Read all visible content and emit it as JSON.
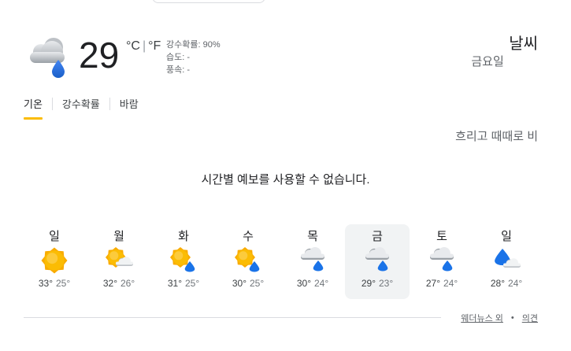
{
  "current": {
    "temperature": "29",
    "unit_c": "°C",
    "unit_sep": "|",
    "unit_f": "°F",
    "icon": "cloud-with-rain-icon",
    "precip": "강수확률: 90%",
    "humidity": "습도: -",
    "wind": "풍속: -"
  },
  "place": {
    "title": "날씨",
    "day": "금요일",
    "condition": "흐리고 때때로 비"
  },
  "tabs": [
    "기온",
    "강수확률",
    "바람"
  ],
  "active_tab": 0,
  "message": "시간별 예보를 사용할 수 없습니다.",
  "days": [
    {
      "name": "일",
      "icon": "sun-icon",
      "high": "33°",
      "low": "25°"
    },
    {
      "name": "월",
      "icon": "sun-cloud-icon",
      "high": "32°",
      "low": "26°"
    },
    {
      "name": "화",
      "icon": "sun-rain-icon",
      "high": "31°",
      "low": "25°"
    },
    {
      "name": "수",
      "icon": "sun-rain-icon",
      "high": "30°",
      "low": "25°"
    },
    {
      "name": "목",
      "icon": "cloud-rain-icon",
      "high": "30°",
      "low": "24°"
    },
    {
      "name": "금",
      "icon": "cloud-rain-icon",
      "high": "29°",
      "low": "23°",
      "selected": true
    },
    {
      "name": "토",
      "icon": "cloud-rain-icon",
      "high": "27°",
      "low": "24°"
    },
    {
      "name": "일",
      "icon": "rain-cloud-icon",
      "high": "28°",
      "low": "24°"
    }
  ],
  "footer": {
    "source": "웨더뉴스 외",
    "separator": "•",
    "feedback": "의견"
  },
  "colors": {
    "sun": "#fbbc04",
    "sun_edge": "#f29900",
    "cloud": "#dadce0",
    "cloud_dark": "#9aa0a6",
    "rain": "#1a73e8",
    "tab_underline": "#fbbc04"
  }
}
